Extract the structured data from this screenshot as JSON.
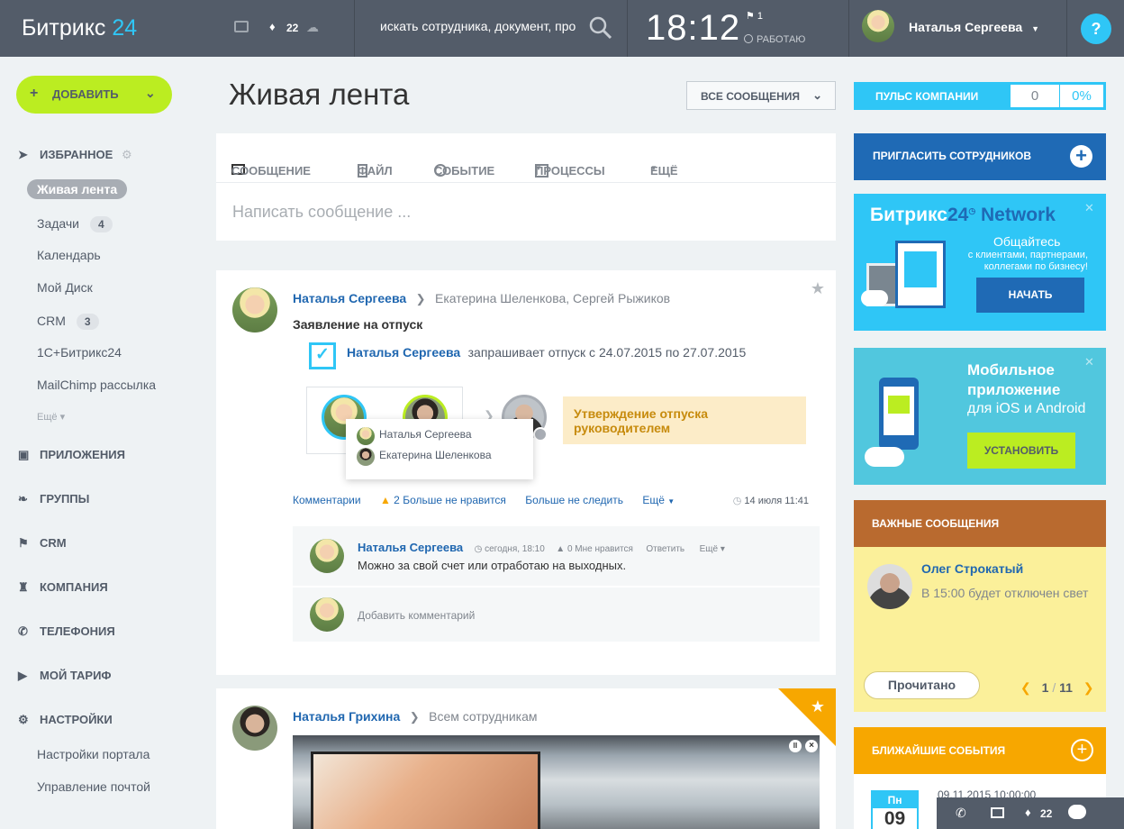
{
  "topbar": {
    "logo_text": "Битрикс",
    "logo_num": "24",
    "notify_count": "22",
    "search_text": "искать сотрудника, документ, про",
    "clock": "18:12",
    "flag_count": "1",
    "work_status": "РАБОТАЮ",
    "user_name": "Наталья Сергеева",
    "help_label": "?"
  },
  "sidebar": {
    "add_label": "ДОБАВИТЬ",
    "favorites_label": "ИЗБРАННОЕ",
    "items": [
      {
        "label": "Живая лента",
        "badge": ""
      },
      {
        "label": "Задачи",
        "badge": "4"
      },
      {
        "label": "Календарь",
        "badge": ""
      },
      {
        "label": "Мой Диск",
        "badge": ""
      },
      {
        "label": "CRM",
        "badge": "3"
      },
      {
        "label": "1С+Битрикс24",
        "badge": ""
      },
      {
        "label": "MailChimp рассылка",
        "badge": ""
      }
    ],
    "more_label": "Ещё",
    "sections": [
      "ПРИЛОЖЕНИЯ",
      "ГРУППЫ",
      "CRM",
      "КОМПАНИЯ",
      "ТЕЛЕФОНИЯ",
      "МОЙ ТАРИФ",
      "НАСТРОЙКИ"
    ],
    "settings_items": [
      "Настройки портала",
      "Управление почтой"
    ]
  },
  "main": {
    "title": "Живая лента",
    "filter_label": "ВСЕ СООБЩЕНИЯ",
    "tabs": [
      "СООБЩЕНИЕ",
      "ФАЙЛ",
      "СОБЫТИЕ",
      "ПРОЦЕССЫ",
      "ЕЩЁ"
    ],
    "compose_placeholder": "Написать сообщение ..."
  },
  "post1": {
    "author": "Наталья Сергеева",
    "recipients": "Екатерина Шеленкова, Сергей Рыжиков",
    "title": "Заявление на отпуск",
    "request_author": "Наталья Сергеева",
    "request_text": "запрашивает отпуск с 24.07.2015 по 27.07.2015",
    "status_text": "Утверждение отпуска руководителем",
    "popup_names": [
      "Наталья Сергеева",
      "Екатерина Шеленкова"
    ],
    "actions": {
      "comments": "Комментарии",
      "likes": "2",
      "unlike": "Больше не нравится",
      "unfollow": "Больше не следить",
      "more": "Ещё"
    },
    "date": "14 июля 11:41",
    "comment": {
      "author": "Наталья Сергеева",
      "time": "сегодня, 18:10",
      "likes": "0",
      "like_label": "Мне нравится",
      "reply": "Ответить",
      "more": "Ещё",
      "text": "Можно за свой счет или отработаю на выходных."
    },
    "add_comment": "Добавить комментарий"
  },
  "post2": {
    "author": "Наталья Грихина",
    "recipients": "Всем сотрудникам"
  },
  "right": {
    "pulse_label": "ПУЛЬС КОМПАНИИ",
    "pulse_value": "0",
    "pulse_percent": "0%",
    "invite_label": "ПРИГЛАСИТЬ СОТРУДНИКОВ",
    "network_title_a": "Битрикс",
    "network_title_b": "24",
    "network_title_c": "Network",
    "network_sub": "Общайтесь",
    "network_text": "с клиентами, партнерами, коллегами по бизнесу!",
    "network_btn": "НАЧАТЬ",
    "mobile_title": "Мобильное приложение",
    "mobile_sub": "для iOS и Android",
    "mobile_btn": "УСТАНОВИТЬ",
    "important_header": "ВАЖНЫЕ СООБЩЕНИЯ",
    "important_author": "Олег Строкатый",
    "important_text": "В 15:00 будет отключен свет",
    "important_btn": "Прочитано",
    "important_page": "1",
    "important_total": "11",
    "events_header": "БЛИЖАЙШИЕ СОБЫТИЯ",
    "event_month": "Пн",
    "event_day": "09",
    "event_time": "09.11.2015 10:00:00"
  },
  "bottom": {
    "notify_count": "22"
  },
  "colors": {
    "topbar": "#535c69",
    "accent": "#2fc6f6",
    "add": "#bbed21",
    "invite": "#1f6ab5",
    "important": "#b96a2f",
    "events": "#f7a700"
  }
}
